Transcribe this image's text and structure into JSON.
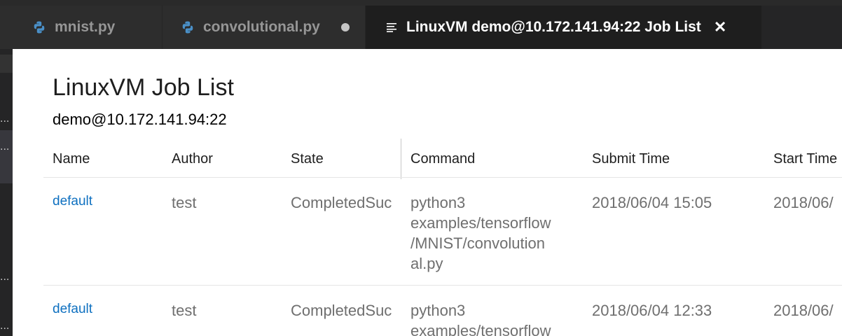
{
  "tabs": [
    {
      "label": "mnist.py",
      "icon": "python-icon",
      "dirty": false,
      "active": false
    },
    {
      "label": "convolutional.py",
      "icon": "python-icon",
      "dirty": true,
      "active": false
    },
    {
      "label": "LinuxVM demo@10.172.141.94:22 Job List",
      "icon": "preview-icon",
      "active": true,
      "close": "✕"
    }
  ],
  "sidebar": {
    "ellipsis": "..."
  },
  "page": {
    "title": "LinuxVM Job List",
    "subtitle": "demo@10.172.141.94:22"
  },
  "table": {
    "columns": [
      "Name",
      "Author",
      "State",
      "Command",
      "Submit Time",
      "Start Time"
    ],
    "rows": [
      {
        "name": "default",
        "author": "test",
        "state": "CompletedSuc",
        "command_lines": [
          "python3",
          "examples/tensorflow",
          "/MNIST/convolution",
          "al.py"
        ],
        "submit_time": "2018/06/04 15:05",
        "start_time": "2018/06/"
      },
      {
        "name": "default",
        "author": "test",
        "state": "CompletedSuc",
        "command_lines": [
          "python3",
          "examples/tensorflow"
        ],
        "submit_time": "2018/06/04 12:33",
        "start_time": "2018/06/"
      }
    ]
  },
  "colors": {
    "link": "#0e70c0",
    "python_icon": "#4a90c8",
    "tab_active_bg": "#1e1e1e",
    "tab_bg": "#2d2d2d"
  }
}
